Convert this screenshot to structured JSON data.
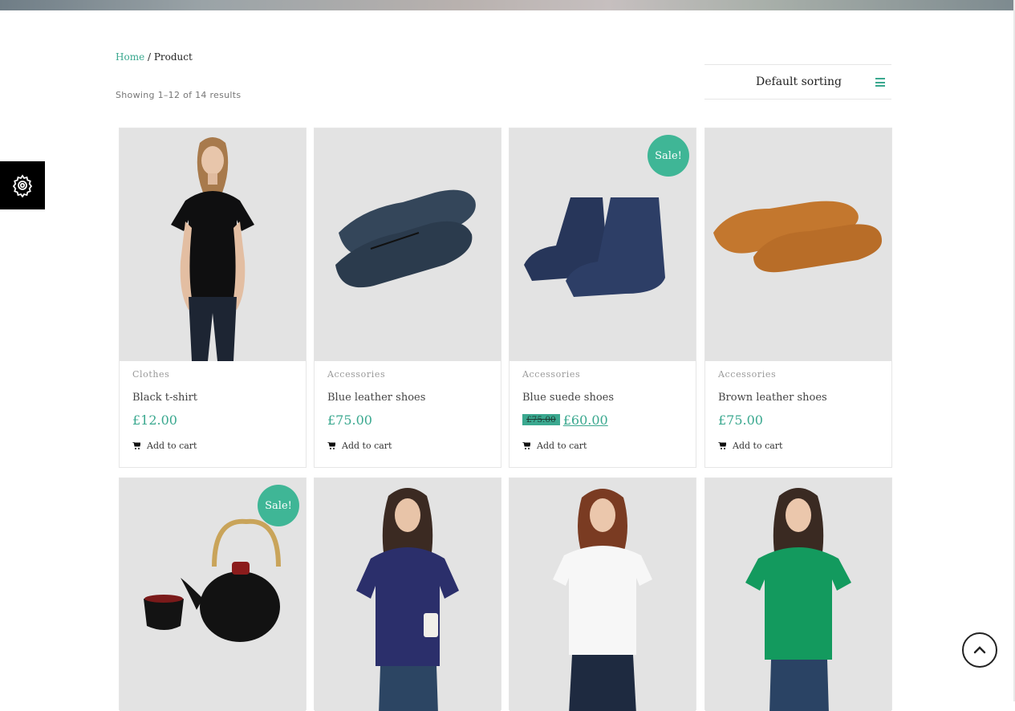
{
  "breadcrumb": {
    "home": "Home",
    "separator": " / ",
    "current": "Product"
  },
  "result_count": "Showing 1–12 of 14 results",
  "sorting": {
    "label": "Default sorting",
    "icon": "menu-icon"
  },
  "colors": {
    "accent": "#3aa88f",
    "sale_badge": "#3fb696",
    "image_bg": "#e3e3e3"
  },
  "sale_label": "Sale!",
  "products": [
    {
      "category": "Clothes",
      "name": "Black t-shirt",
      "price": "£12.00",
      "cart": "Add to cart"
    },
    {
      "category": "Accessories",
      "name": "Blue leather shoes",
      "price": "£75.00",
      "cart": "Add to cart"
    },
    {
      "category": "Accessories",
      "name": "Blue suede shoes",
      "old_price": "£75.00",
      "price": "£60.00",
      "cart": "Add to cart"
    },
    {
      "category": "Accessories",
      "name": "Brown leather shoes",
      "price": "£75.00",
      "cart": "Add to cart"
    }
  ]
}
